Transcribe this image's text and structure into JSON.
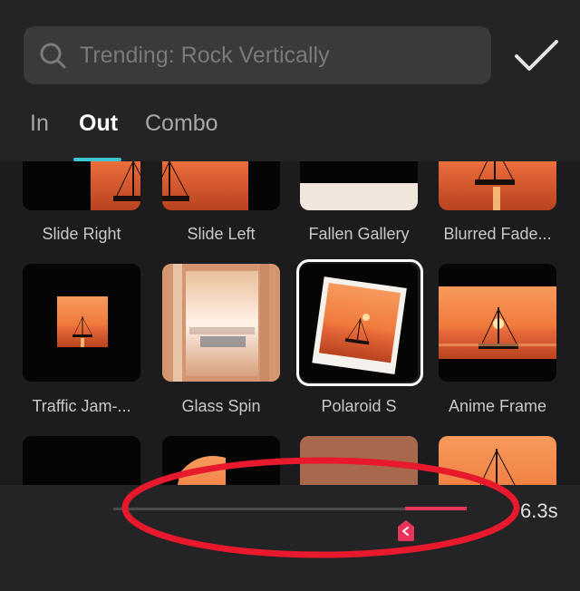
{
  "search": {
    "placeholder": "Trending: Rock Vertically"
  },
  "tabs": [
    {
      "label": "In",
      "active": false
    },
    {
      "label": "Out",
      "active": true
    },
    {
      "label": "Combo",
      "active": false
    }
  ],
  "effects": [
    {
      "label": "Slide Right"
    },
    {
      "label": "Slide Left"
    },
    {
      "label": "Fallen Gallery"
    },
    {
      "label": "Blurred Fade..."
    },
    {
      "label": "Traffic Jam-..."
    },
    {
      "label": "Glass Spin"
    },
    {
      "label": "Polaroid S",
      "selected": true
    },
    {
      "label": "Anime Frame"
    }
  ],
  "timeline": {
    "duration": "6.3s"
  },
  "colors": {
    "accent_tab": "#3fc4d0",
    "slider_active": "#e8345a",
    "annotation": "#e8192c"
  },
  "icons": {
    "search": "search-icon",
    "confirm": "checkmark-icon",
    "handle": "chevron-left-icon"
  }
}
